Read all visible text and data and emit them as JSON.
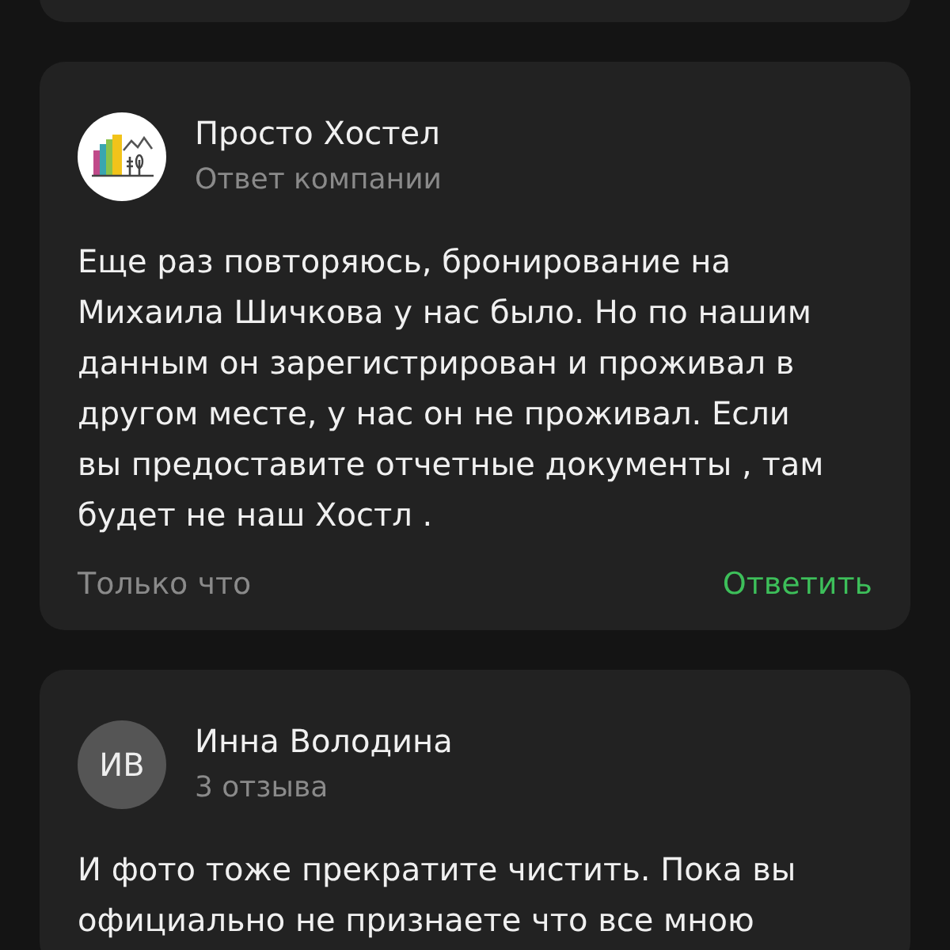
{
  "reviews": [
    {
      "kind": "company",
      "author": "Просто Хостел",
      "subtitle": "Ответ компании",
      "text": "Еще раз повторяюсь, бронирование на Михаила Шичкова у нас было. Но по нашим данным он зарегистрирован и проживал в другом месте, у нас он не проживал. Если вы предоставите отчетные документы , там будет не наш Хостл .",
      "time": "Только что",
      "reply": "Ответить"
    },
    {
      "kind": "user",
      "initials": "ИВ",
      "author": "Инна Володина",
      "subtitle": "3 отзыва",
      "text": "И фото тоже прекратите чистить. Пока вы официально не признаете что все мною"
    }
  ]
}
